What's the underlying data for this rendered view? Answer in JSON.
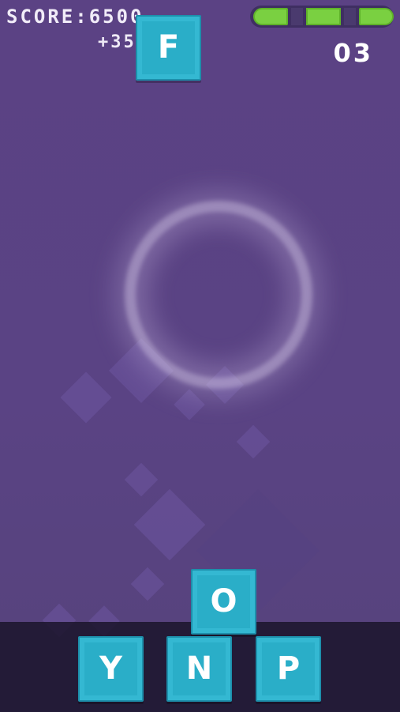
{
  "hud": {
    "score_text": "SCORE:6500",
    "bonus_text": "+350",
    "level_text": "03",
    "health_segments": 3,
    "health_filled": 3
  },
  "board": {
    "falling_tile": "F",
    "stacked_tile": "O"
  },
  "tray": {
    "choices": [
      "Y",
      "N",
      "P"
    ]
  },
  "colors": {
    "background": "#5a4384",
    "tile": "#2aaec8",
    "health": "#7ad041",
    "tray": "#1c162e"
  }
}
